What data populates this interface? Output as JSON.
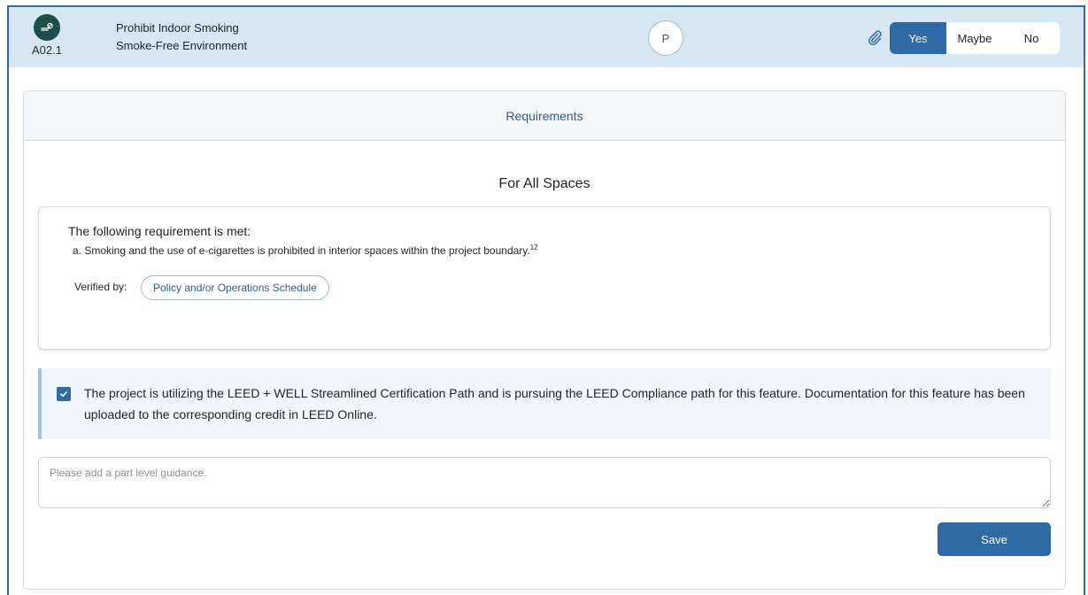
{
  "header": {
    "feature_code": "A02.1",
    "title_line1": "Prohibit Indoor Smoking",
    "title_line2": "Smoke-Free Environment",
    "phase": "P",
    "options": [
      "Yes",
      "Maybe",
      "No"
    ],
    "selected_option": "Yes",
    "icons": {
      "feature": "smoke-free-icon",
      "attachment": "paperclip-icon"
    }
  },
  "card": {
    "header": "Requirements",
    "section_title": "For All Spaces",
    "requirement": {
      "lead": "The following requirement is met:",
      "item": "a. Smoking and the use of e-cigarettes is prohibited in interior spaces within the project boundary.",
      "item_sup": "12",
      "verified_label": "Verified by:",
      "verified_by": "Policy and/or Operations Schedule"
    },
    "leed": {
      "checked": true,
      "text": "The project is utilizing the LEED + WELL Streamlined Certification Path and is pursuing the LEED Compliance path for this feature. Documentation for this feature has been uploaded to the corresponding credit in LEED Online."
    },
    "guidance_placeholder": "Please add a part level guidance.",
    "save_label": "Save"
  },
  "colors": {
    "primary": "#2f6aa4",
    "header_bg": "#d6e6f3",
    "feature_icon_bg": "#1d4e4a",
    "accent_border": "#9fc3e4"
  }
}
